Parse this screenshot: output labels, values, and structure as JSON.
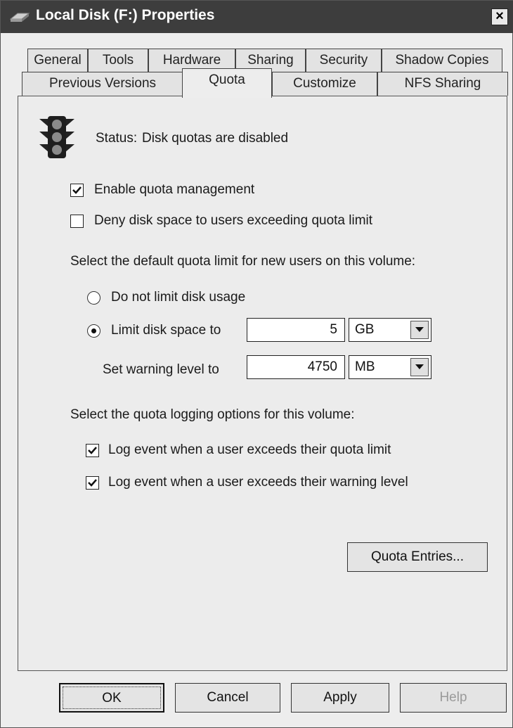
{
  "window": {
    "title": "Local Disk (F:) Properties",
    "close_label": "×"
  },
  "tabs_row1": [
    "General",
    "Tools",
    "Hardware",
    "Sharing",
    "Security",
    "Shadow Copies"
  ],
  "tabs_row2": [
    "Previous Versions",
    "Quota",
    "Customize",
    "NFS Sharing"
  ],
  "active_tab": "Quota",
  "status": {
    "label": "Status:",
    "text": "Disk quotas are disabled",
    "icon": "traffic-light-icon"
  },
  "options": {
    "enable_quota": {
      "label": "Enable quota management",
      "checked": true
    },
    "deny_space": {
      "label": "Deny disk space to users exceeding quota limit",
      "checked": false
    }
  },
  "default_limit": {
    "heading": "Select the default quota limit for new users on this volume:",
    "no_limit": {
      "label": "Do not limit disk usage",
      "selected": false
    },
    "limit": {
      "label": "Limit disk space to",
      "selected": true,
      "value": "5",
      "unit": "GB"
    },
    "warning": {
      "label": "Set warning level to",
      "value": "4750",
      "unit": "MB"
    }
  },
  "logging": {
    "heading": "Select the quota logging options for this volume:",
    "log_limit": {
      "label": "Log event when a user exceeds their quota limit",
      "checked": true
    },
    "log_warning": {
      "label": "Log event when a user exceeds their warning level",
      "checked": true
    }
  },
  "quota_entries_label": "Quota Entries...",
  "buttons": {
    "ok": "OK",
    "cancel": "Cancel",
    "apply": "Apply",
    "help": "Help"
  }
}
